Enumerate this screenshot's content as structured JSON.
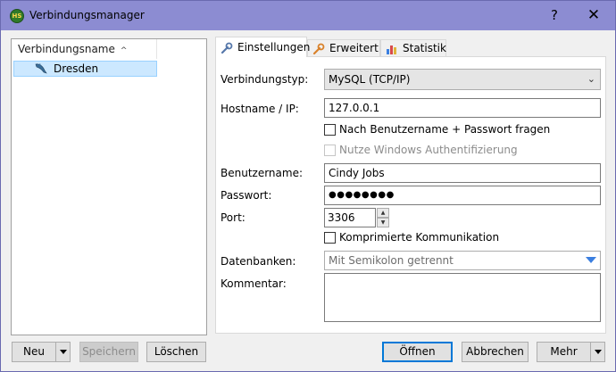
{
  "window": {
    "title": "Verbindungsmanager",
    "app_icon_text": "HS",
    "help_label": "?",
    "close_label": "✕"
  },
  "connections": {
    "column_header": "Verbindungsname",
    "sort_indicator": "^",
    "items": [
      {
        "label": "Dresden",
        "selected": true,
        "icon": "dolphin-icon"
      }
    ]
  },
  "tabs": [
    {
      "label": "Einstellungen",
      "icon": "wrench-icon",
      "active": true
    },
    {
      "label": "Erweitert",
      "icon": "wrench-orange-icon",
      "active": false
    },
    {
      "label": "Statistik",
      "icon": "bar-chart-icon",
      "active": false
    }
  ],
  "settings": {
    "connection_type": {
      "label": "Verbindungstyp:",
      "value": "MySQL (TCP/IP)"
    },
    "hostname": {
      "label": "Hostname / IP:",
      "value": "127.0.0.1"
    },
    "ask_credentials": {
      "label": "Nach Benutzername + Passwort fragen",
      "checked": false
    },
    "windows_auth": {
      "label": "Nutze Windows Authentifizierung",
      "checked": false,
      "disabled": true
    },
    "username": {
      "label": "Benutzername:",
      "value": "Cindy Jobs"
    },
    "password": {
      "label": "Passwort:",
      "value": "●●●●●●●●"
    },
    "port": {
      "label": "Port:",
      "value": "3306"
    },
    "compression": {
      "label": "Komprimierte Kommunikation",
      "checked": false
    },
    "databases": {
      "label": "Datenbanken:",
      "placeholder": "Mit Semikolon getrennt"
    },
    "comment": {
      "label": "Kommentar:",
      "value": ""
    }
  },
  "buttons": {
    "new": "Neu",
    "save": "Speichern",
    "delete": "Löschen",
    "open": "Öffnen",
    "cancel": "Abbrechen",
    "more": "Mehr"
  },
  "colors": {
    "titlebar": "#8c8cd2",
    "selection": "#cce8ff",
    "accent": "#0078d7"
  }
}
